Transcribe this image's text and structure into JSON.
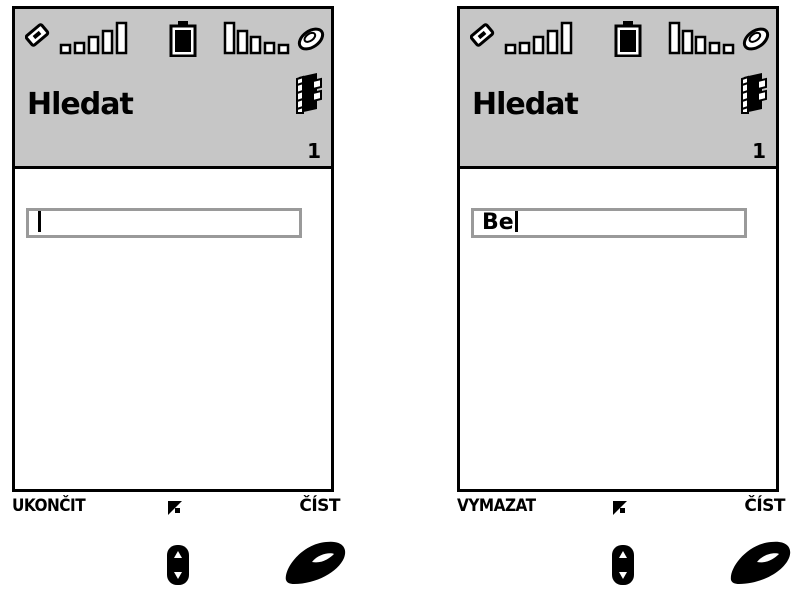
{
  "screens": [
    {
      "title": "Hledat",
      "page_number": "1",
      "search_value": "",
      "softkey_left": "UKONČIT",
      "softkey_right": "ČÍST"
    },
    {
      "title": "Hledat",
      "page_number": "1",
      "search_value": "Be",
      "softkey_left": "VYMAZAT",
      "softkey_right": "ČÍST"
    }
  ],
  "icons": {
    "signal": "signal-strength-icon",
    "battery": "battery-icon",
    "network": "network-strength-icon",
    "phonebook": "phonebook-icon",
    "edit": "edit-mode-icon",
    "scroll": "scroll-key-icon",
    "call": "call-key-icon"
  },
  "colors": {
    "header_bg": "#c6c6c6",
    "field_border": "#9a9a9a",
    "ink": "#000000"
  }
}
